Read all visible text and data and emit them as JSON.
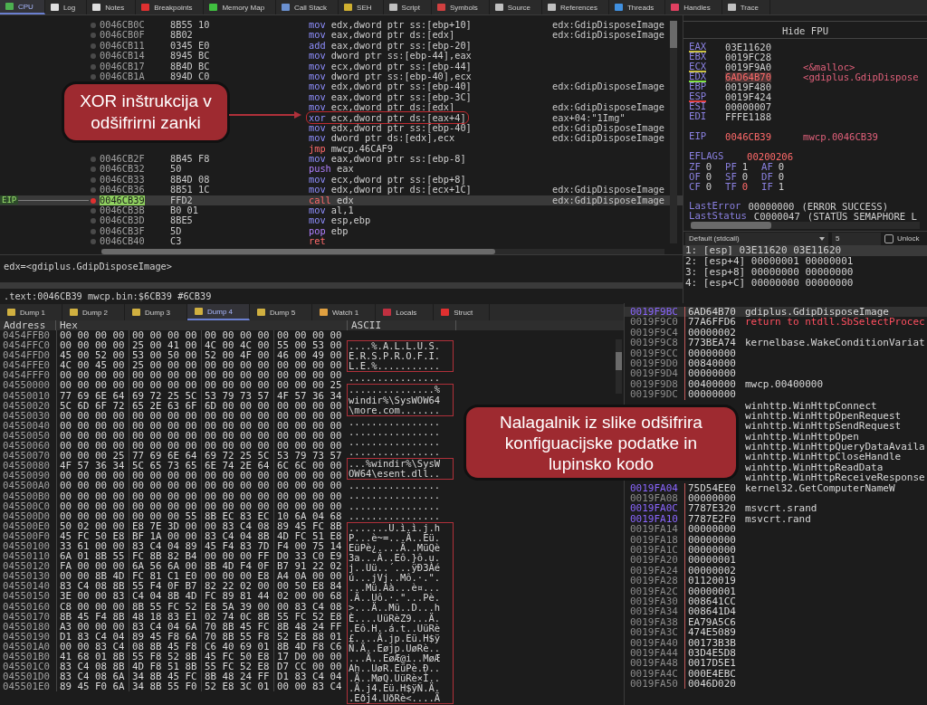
{
  "tabs": [
    {
      "label": "CPU",
      "selected": true,
      "color": "#4caf50"
    },
    {
      "label": "Log",
      "selected": false,
      "color": "#e0e0e0"
    },
    {
      "label": "Notes",
      "selected": false,
      "color": "#e0e0e0"
    },
    {
      "label": "Breakpoints",
      "selected": false,
      "color": "#e03030"
    },
    {
      "label": "Memory Map",
      "selected": false,
      "color": "#40c040"
    },
    {
      "label": "Call Stack",
      "selected": false,
      "color": "#6a90d0"
    },
    {
      "label": "SEH",
      "selected": false,
      "color": "#d0b030"
    },
    {
      "label": "Script",
      "selected": false,
      "color": "#c0c0c0"
    },
    {
      "label": "Symbols",
      "selected": false,
      "color": "#d04040"
    },
    {
      "label": "Source",
      "selected": false,
      "color": "#c0c0c0"
    },
    {
      "label": "References",
      "selected": false,
      "color": "#c0c0c0"
    },
    {
      "label": "Threads",
      "selected": false,
      "color": "#4090e0"
    },
    {
      "label": "Handles",
      "selected": false,
      "color": "#e04060"
    },
    {
      "label": "Trace",
      "selected": false,
      "color": "#c0c0c0"
    }
  ],
  "disassembly": {
    "eip_label": "EIP",
    "rows": [
      {
        "address": "0046CB0C",
        "bytes": "8B55 10",
        "kind": "move",
        "mnemonic": "mov",
        "operands": "edx,dword ptr ss:[ebp+10]",
        "comment": "edx:GdipDisposeImage",
        "current": false,
        "circled": false
      },
      {
        "address": "0046CB0F",
        "bytes": "8B02",
        "kind": "move",
        "mnemonic": "mov",
        "operands": "eax,dword ptr ds:[edx]",
        "comment": "edx:GdipDisposeImage",
        "current": false,
        "circled": false
      },
      {
        "address": "0046CB11",
        "bytes": "0345 E0",
        "kind": "move",
        "mnemonic": "add",
        "operands": "eax,dword ptr ss:[ebp-20]",
        "current": false,
        "circled": false
      },
      {
        "address": "0046CB14",
        "bytes": "8945 BC",
        "kind": "move",
        "mnemonic": "mov",
        "operands": "dword ptr ss:[ebp-44],eax",
        "current": false,
        "circled": false
      },
      {
        "address": "0046CB17",
        "bytes": "8B4D BC",
        "kind": "move",
        "mnemonic": "mov",
        "operands": "ecx,dword ptr ss:[ebp-44]",
        "current": false,
        "circled": false
      },
      {
        "address": "0046CB1A",
        "bytes": "894D C0",
        "kind": "move",
        "mnemonic": "mov",
        "operands": "dword ptr ss:[ebp-40],ecx",
        "current": false,
        "circled": false
      },
      {
        "kind": "move",
        "mnemonic": "mov",
        "operands": "edx,dword ptr ss:[ebp-40]",
        "comment": "edx:GdipDisposeImage",
        "current": false,
        "circled": false
      },
      {
        "kind": "move",
        "mnemonic": "mov",
        "operands": "eax,dword ptr ss:[ebp-3C]",
        "current": false,
        "circled": false
      },
      {
        "kind": "move",
        "mnemonic": "mov",
        "operands": "ecx,dword ptr ds:[edx]",
        "comment": "edx:GdipDisposeImage",
        "current": false,
        "circled": false
      },
      {
        "kind": "move",
        "mnemonic": "xor",
        "operands": "ecx,dword ptr ds:[eax+4]",
        "comment": "eax+04:\"1Img\"",
        "current": false,
        "circled": true
      },
      {
        "kind": "move",
        "mnemonic": "mov",
        "operands": "edx,dword ptr ss:[ebp-40]",
        "comment": "edx:GdipDisposeImage",
        "current": false,
        "circled": false
      },
      {
        "kind": "move",
        "mnemonic": "mov",
        "operands": "dword ptr ds:[edx],ecx",
        "comment": "edx:GdipDisposeImage",
        "current": false,
        "circled": false
      },
      {
        "kind": "jump",
        "mnemonic": "jmp",
        "operands": "mwcp.46CAF9",
        "current": false,
        "circled": false
      },
      {
        "address": "0046CB2F",
        "bytes": "8B45 F8",
        "kind": "move",
        "mnemonic": "mov",
        "operands": "eax,dword ptr ss:[ebp-8]",
        "current": false,
        "circled": false
      },
      {
        "address": "0046CB32",
        "bytes": "50",
        "kind": "stack",
        "mnemonic": "push",
        "operands": "eax",
        "current": false,
        "circled": false
      },
      {
        "address": "0046CB33",
        "bytes": "8B4D 08",
        "kind": "move",
        "mnemonic": "mov",
        "operands": "ecx,dword ptr ss:[ebp+8]",
        "current": false,
        "circled": false
      },
      {
        "address": "0046CB36",
        "bytes": "8B51 1C",
        "kind": "move",
        "mnemonic": "mov",
        "operands": "edx,dword ptr ds:[ecx+1C]",
        "comment": "edx:GdipDisposeImage",
        "current": false,
        "circled": false
      },
      {
        "address": "0046CB39",
        "bytes": "FFD2",
        "kind": "call",
        "mnemonic": "call",
        "operands": "edx",
        "comment": "edx:GdipDisposeImage",
        "current": true,
        "circled": false
      },
      {
        "address": "0046CB3B",
        "bytes": "B0 01",
        "kind": "move",
        "mnemonic": "mov",
        "operands": "al,1",
        "current": false,
        "circled": false
      },
      {
        "address": "0046CB3D",
        "bytes": "8BE5",
        "kind": "move",
        "mnemonic": "mov",
        "operands": "esp,ebp",
        "current": false,
        "circled": false
      },
      {
        "address": "0046CB3F",
        "bytes": "5D",
        "kind": "stack",
        "mnemonic": "pop",
        "operands": "ebp",
        "current": false,
        "circled": false
      },
      {
        "address": "0046CB40",
        "bytes": "C3",
        "kind": "call",
        "mnemonic": "ret",
        "current": false,
        "circled": false
      }
    ]
  },
  "info": {
    "line": "edx=<gdiplus.GdipDisposeImage>",
    "location": ".text:0046CB39 mwcp.bin:$6CB39 #6CB39"
  },
  "registers": {
    "header": "Hide FPU",
    "general": [
      {
        "name": "EAX",
        "value": "03E11620",
        "changed": false,
        "color": "#c8c040"
      },
      {
        "name": "EBX",
        "value": "0019FC28",
        "changed": false
      },
      {
        "name": "ECX",
        "value": "0019F9A0",
        "comment": "<&malloc>",
        "changed": false,
        "color": "#c8c040"
      },
      {
        "name": "EDX",
        "value": "6AD64B70",
        "comment": "<gdiplus.GdipDispose",
        "changed": true,
        "color": "#80e040"
      },
      {
        "name": "EBP",
        "value": "0019F480",
        "changed": false
      },
      {
        "name": "ESP",
        "value": "0019F424",
        "changed": false,
        "color": "#e04040"
      },
      {
        "name": "ESI",
        "value": "00000007",
        "changed": false
      },
      {
        "name": "EDI",
        "value": "FFFE1188",
        "changed": false
      }
    ],
    "eip": {
      "name": "EIP",
      "value": "0046CB39",
      "comment": "mwcp.0046CB39",
      "changed": true
    },
    "eflags": {
      "name": "EFLAGS",
      "value": "00200206",
      "changed": true
    },
    "flags": [
      {
        "name": "ZF",
        "value": "0",
        "changed": false
      },
      {
        "name": "PF",
        "value": "1",
        "changed": false
      },
      {
        "name": "AF",
        "value": "0",
        "changed": false
      },
      {
        "name": "OF",
        "value": "0",
        "changed": false
      },
      {
        "name": "SF",
        "value": "0",
        "changed": false
      },
      {
        "name": "DF",
        "value": "0",
        "changed": false
      },
      {
        "name": "CF",
        "value": "0",
        "changed": false
      },
      {
        "name": "TF",
        "value": "0",
        "changed": true
      },
      {
        "name": "IF",
        "value": "1",
        "changed": false
      }
    ],
    "last": [
      {
        "name": "LastError",
        "value": "00000000",
        "description": "(ERROR_SUCCESS)"
      },
      {
        "name": "LastStatus",
        "value": "C0000047",
        "description": "(STATUS_SEMAPHORE_L"
      }
    ]
  },
  "call_args": {
    "convention": "Default (stdcall)",
    "count": "5",
    "unlock": {
      "label": "Unlock",
      "checked": false
    },
    "rows": [
      {
        "text": "1: [esp] 03E11620 03E11620",
        "selected": true
      },
      {
        "text": "2: [esp+4] 00000001 00000001",
        "selected": false
      },
      {
        "text": "3: [esp+8] 00000000 00000000",
        "selected": false
      },
      {
        "text": "4: [esp+C] 00000000 00000000",
        "selected": false
      }
    ]
  },
  "dump_tabs": [
    {
      "label": "Dump 1",
      "selected": false,
      "color": "#d0b040"
    },
    {
      "label": "Dump 2",
      "selected": false,
      "color": "#d0b040"
    },
    {
      "label": "Dump 3",
      "selected": false,
      "color": "#d0b040"
    },
    {
      "label": "Dump 4",
      "selected": true,
      "color": "#d0b040"
    },
    {
      "label": "Dump 5",
      "selected": false,
      "color": "#d0b040"
    },
    {
      "label": "Watch 1",
      "selected": false,
      "color": "#e0a040"
    },
    {
      "label": "Locals",
      "selected": false,
      "color": "#c03040"
    },
    {
      "label": "Struct",
      "selected": false,
      "color": "#e03030"
    }
  ],
  "dump": {
    "columns": [
      "Address",
      "Hex",
      "ASCII"
    ],
    "rows": [
      {
        "address": "0454FFB0",
        "hex": [
          "00 00 00 00",
          "00 00 00 00",
          "00 00 00 00",
          "00 00 00 00"
        ]
      },
      {
        "address": "0454FFC0",
        "hex": [
          "00 00 00 00",
          "25 00 41 00",
          "4C 00 4C 00",
          "55 00 53 00"
        ]
      },
      {
        "address": "0454FFD0",
        "hex": [
          "45 00 52 00",
          "53 00 50 00",
          "52 00 4F 00",
          "46 00 49 00"
        ]
      },
      {
        "address": "0454FFE0",
        "hex": [
          "4C 00 45 00",
          "25 00 00 00",
          "00 00 00 00",
          "00 00 00 00"
        ]
      },
      {
        "address": "0454FFF0",
        "hex": [
          "00 00 00 00",
          "00 00 00 00",
          "00 00 00 00",
          "00 00 00 00"
        ]
      },
      {
        "address": "04550000",
        "hex": [
          "00 00 00 00",
          "00 00 00 00",
          "00 00 00 00",
          "00 00 00 25"
        ]
      },
      {
        "address": "04550010",
        "hex": [
          "77 69 6E 64",
          "69 72 25 5C",
          "53 79 73 57",
          "4F 57 36 34"
        ]
      },
      {
        "address": "04550020",
        "hex": [
          "5C 6D 6F 72",
          "65 2E 63 6F",
          "6D 00 00 00",
          "00 00 00 00"
        ]
      },
      {
        "address": "04550030",
        "hex": [
          "00 00 00 00",
          "00 00 00 00",
          "00 00 00 00",
          "00 00 00 00"
        ]
      },
      {
        "address": "04550040",
        "hex": [
          "00 00 00 00",
          "00 00 00 00",
          "00 00 00 00",
          "00 00 00 00"
        ]
      },
      {
        "address": "04550050",
        "hex": [
          "00 00 00 00",
          "00 00 00 00",
          "00 00 00 00",
          "00 00 00 00"
        ]
      },
      {
        "address": "04550060",
        "hex": [
          "00 00 00 00",
          "00 00 00 00",
          "00 00 00 00",
          "00 00 00 00"
        ]
      },
      {
        "address": "04550070",
        "hex": [
          "00 00 00 25",
          "77 69 6E 64",
          "69 72 25 5C",
          "53 79 73 57"
        ]
      },
      {
        "address": "04550080",
        "hex": [
          "4F 57 36 34",
          "5C 65 73 65",
          "6E 74 2E 64",
          "6C 6C 00 00"
        ]
      },
      {
        "address": "04550090",
        "hex": [
          "00 00 00 00",
          "00 00 00 00",
          "00 00 00 00",
          "00 00 00 00"
        ]
      },
      {
        "address": "045500A0",
        "hex": [
          "00 00 00 00",
          "00 00 00 00",
          "00 00 00 00",
          "00 00 00 00"
        ]
      },
      {
        "address": "045500B0",
        "hex": [
          "00 00 00 00",
          "00 00 00 00",
          "00 00 00 00",
          "00 00 00 00"
        ]
      },
      {
        "address": "045500C0",
        "hex": [
          "00 00 00 00",
          "00 00 00 00",
          "00 00 00 00",
          "00 00 00 00"
        ]
      },
      {
        "address": "045500D0",
        "hex": [
          "00 00 00 00",
          "00 00 00 55",
          "8B EC 83 EC",
          "10 6A 04 68"
        ]
      },
      {
        "address": "045500E0",
        "hex": [
          "50 02 00 00",
          "E8 7E 3D 00",
          "00 83 C4 08",
          "89 45 FC 8B"
        ]
      },
      {
        "address": "045500F0",
        "hex": [
          "45 FC 50 E8",
          "BF 1A 00 00",
          "83 C4 04 8B",
          "4D FC 51 E8"
        ]
      },
      {
        "address": "04550100",
        "hex": [
          "33 61 00 00",
          "83 C4 04 89",
          "45 F4 83 7D",
          "F4 00 75 14"
        ]
      },
      {
        "address": "04550110",
        "hex": [
          "6A 01 8B 55",
          "FC 8B 82 B4",
          "00 00 00 FF",
          "D0 33 C0 E9"
        ]
      },
      {
        "address": "04550120",
        "hex": [
          "FA 00 00 00",
          "6A 56 6A 00",
          "8B 4D F4 0F",
          "B7 91 22 02"
        ]
      },
      {
        "address": "04550130",
        "hex": [
          "00 00 8B 4D",
          "FC 81 C1 E0",
          "00 00 00 E8",
          "A4 0A 00 00"
        ]
      },
      {
        "address": "04550140",
        "hex": [
          "83 C4 08 8B",
          "55 F4 0F B7",
          "82 22 02 00",
          "00 50 E8 84"
        ]
      },
      {
        "address": "04550150",
        "hex": [
          "3E 00 00 83",
          "C4 04 8B 4D",
          "FC 89 81 44",
          "02 00 00 68"
        ]
      },
      {
        "address": "04550160",
        "hex": [
          "C8 00 00 00",
          "8B 55 FC 52",
          "E8 5A 39 00",
          "00 83 C4 08"
        ]
      },
      {
        "address": "04550170",
        "hex": [
          "8B 45 F4 8B",
          "48 18 83 E1",
          "02 74 0C 8B",
          "55 FC 52 E8"
        ]
      },
      {
        "address": "04550180",
        "hex": [
          "A3 00 00 00",
          "83 C4 04 6A",
          "70 8B 45 FC",
          "8B 48 24 FF"
        ]
      },
      {
        "address": "04550190",
        "hex": [
          "D1 83 C4 04",
          "89 45 F8 6A",
          "70 8B 55 F8",
          "52 E8 88 01"
        ]
      },
      {
        "address": "045501A0",
        "hex": [
          "00 00 83 C4",
          "08 8B 45 F8",
          "C6 40 69 01",
          "8B 4D F8 C6"
        ]
      },
      {
        "address": "045501B0",
        "hex": [
          "41 68 01 8B",
          "55 F8 52 8B",
          "45 FC 50 E8",
          "17 D0 00 00"
        ]
      },
      {
        "address": "045501C0",
        "hex": [
          "83 C4 08 8B",
          "4D F8 51 8B",
          "55 FC 52 E8",
          "D7 CC 00 00"
        ]
      },
      {
        "address": "045501D0",
        "hex": [
          "83 C4 08 6A",
          "34 8B 45 FC",
          "8B 48 24 FF",
          "D1 83 C4 04"
        ]
      },
      {
        "address": "045501E0",
        "hex": [
          "89 45 F0 6A",
          "34 8B 55 F0",
          "52 E8 3C 01",
          "00 00 83 C4"
        ]
      }
    ],
    "ascii_blocks": [
      {
        "boxed": true,
        "lines": [
          "....%.A.L.L.U.S.",
          "E.R.S.P.R.O.F.I.",
          "L.E.%..........."
        ]
      },
      {
        "boxed": false,
        "lines": [
          "................"
        ]
      },
      {
        "boxed": true,
        "lines": [
          "...............%",
          "windir%\\SysWOW64",
          "\\more.com......."
        ]
      },
      {
        "boxed": false,
        "lines": [
          "................",
          "................",
          "................",
          "................"
        ]
      },
      {
        "boxed": true,
        "lines": [
          "...%windir%\\SysW",
          "OW64\\esent.dll.."
        ]
      },
      {
        "boxed": false,
        "lines": [
          "................",
          "................",
          "................",
          "................"
        ]
      },
      {
        "boxed": true,
        "lines": [
          ".......U.ì.ì.j.h",
          "P...è~=...Ä..Eü.",
          "EüPè¿....Ä..MüQè",
          "3a...Ä..Eô.}ô.u.",
          "j..Uü..´...ÿÐ3Àé",
          "ú...jVj..Mô.·.\".",
          "...Mü.Áà...è¤...",
          ".Ä..Uô.·.\"...Pè.",
          ">...Ä..Mü..D...h",
          "È....UüRèZ9...Ä.",
          ".Eô.H..á.t..UüRè",
          "£....Ä.jp.Eü.H$ÿ",
          "Ñ.Ä..Eøjp.UøRè..",
          "...Ä..EøÆ@i..MøÆ",
          "Ah..UøR.EüPè.Ð..",
          ".Ä..MøQ.UüRè×Ì..",
          ".Ä.j4.Eü.H$ÿÑ.Ä.",
          ".Eðj4.UðRè<....Ä"
        ]
      }
    ]
  },
  "stack": {
    "rows": [
      {
        "address": "0019F9BC",
        "value": "6AD64B70",
        "comment": "gdiplus.GdipDisposeImage",
        "kind": "plain",
        "highlight": true,
        "selected": true
      },
      {
        "address": "0019F9C0",
        "value": "77A6FFD6",
        "comment": "return to ntdll.SbSelectProcec",
        "kind": "return",
        "highlight": false,
        "selected": false
      },
      {
        "address": "0019F9C4",
        "value": "00000002",
        "highlight": false,
        "selected": false
      },
      {
        "address": "0019F9C8",
        "value": "773BEA74",
        "comment": "kernelbase.WakeConditionVariat",
        "kind": "plain",
        "highlight": false,
        "selected": false
      },
      {
        "address": "0019F9CC",
        "value": "00000000",
        "highlight": false,
        "selected": false
      },
      {
        "address": "0019F9D0",
        "value": "00840000",
        "highlight": false,
        "selected": false
      },
      {
        "address": "0019F9D4",
        "value": "00000000",
        "highlight": false,
        "selected": false
      },
      {
        "address": "0019F9D8",
        "value": "00400000",
        "comment": "mwcp.00400000",
        "kind": "plain",
        "highlight": false,
        "selected": false
      },
      {
        "address": "0019F9DC",
        "value": "00000000",
        "highlight": false,
        "selected": false
      },
      {
        "comment": "winhttp.WinHttpConnect",
        "kind": "plain",
        "selected": false
      },
      {
        "comment": "winhttp.WinHttpOpenRequest",
        "kind": "plain",
        "selected": false
      },
      {
        "comment": "winhttp.WinHttpSendRequest",
        "kind": "plain",
        "selected": false
      },
      {
        "comment": "winhttp.WinHttpOpen",
        "kind": "plain",
        "selected": false
      },
      {
        "comment": "winhttp.WinHttpQueryDataAvaila",
        "kind": "plain",
        "selected": false
      },
      {
        "comment": "winhttp.WinHttpCloseHandle",
        "kind": "plain",
        "selected": false
      },
      {
        "comment": "winhttp.WinHttpReadData",
        "kind": "plain",
        "selected": false
      },
      {
        "comment": "winhttp.WinHttpReceiveResponse",
        "kind": "plain",
        "selected": false
      },
      {
        "address": "0019FA04",
        "value": "75D54EE0",
        "comment": "kernel32.GetComputerNameW",
        "kind": "plain",
        "highlight": true,
        "selected": false
      },
      {
        "address": "0019FA08",
        "value": "00000000",
        "highlight": false,
        "selected": false
      },
      {
        "address": "0019FA0C",
        "value": "7787E320",
        "comment": "msvcrt.srand",
        "kind": "plain",
        "highlight": true,
        "selected": false
      },
      {
        "address": "0019FA10",
        "value": "7787E2F0",
        "comment": "msvcrt.rand",
        "kind": "plain",
        "highlight": true,
        "selected": false
      },
      {
        "address": "0019FA14",
        "value": "00000000",
        "highlight": false,
        "selected": false
      },
      {
        "address": "0019FA18",
        "value": "00000000",
        "highlight": false,
        "selected": false
      },
      {
        "address": "0019FA1C",
        "value": "00000000",
        "highlight": false,
        "selected": false
      },
      {
        "address": "0019FA20",
        "value": "00000001",
        "highlight": false,
        "selected": false
      },
      {
        "address": "0019FA24",
        "value": "00000002",
        "highlight": false,
        "selected": false
      },
      {
        "address": "0019FA28",
        "value": "01120019",
        "highlight": false,
        "selected": false
      },
      {
        "address": "0019FA2C",
        "value": "00000001",
        "highlight": false,
        "selected": false
      },
      {
        "address": "0019FA30",
        "value": "008641CC",
        "highlight": false,
        "selected": false
      },
      {
        "address": "0019FA34",
        "value": "008641D4",
        "highlight": false,
        "selected": false
      },
      {
        "address": "0019FA38",
        "value": "EA79A5C6",
        "highlight": false,
        "selected": false
      },
      {
        "address": "0019FA3C",
        "value": "474E5089",
        "highlight": false,
        "selected": false
      },
      {
        "address": "0019FA40",
        "value": "00173B3B",
        "highlight": false,
        "selected": false
      },
      {
        "address": "0019FA44",
        "value": "03D4E5D8",
        "highlight": false,
        "selected": false
      },
      {
        "address": "0019FA48",
        "value": "0017D5E1",
        "highlight": false,
        "selected": false
      },
      {
        "address": "0019FA4C",
        "value": "000E4EBC",
        "highlight": false,
        "selected": false
      },
      {
        "address": "0019FA50",
        "value": "0046D020",
        "highlight": false,
        "selected": false
      }
    ]
  },
  "callouts": [
    {
      "text": "XOR inštrukcija v odšifrirni zanki"
    },
    {
      "text": "Nalagalnik iz slike odšifrira konfiguacijske podatke in lupinsko kodo"
    }
  ]
}
